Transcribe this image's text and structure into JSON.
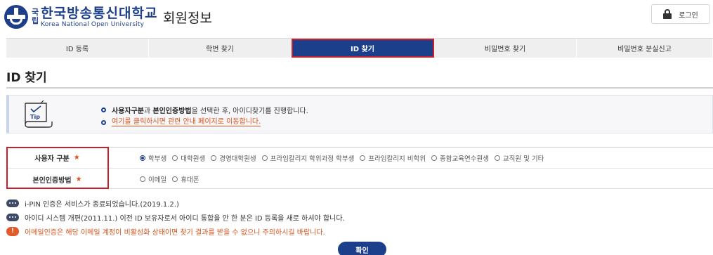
{
  "header": {
    "logo_guklip_top": "국",
    "logo_guklip_bottom": "립",
    "logo_ko": "한국방송통신대학교",
    "logo_en": "Korea National Open University",
    "page_heading": "회원정보",
    "login_label": "로그인"
  },
  "tabs": [
    {
      "label": "ID 등록",
      "active": false
    },
    {
      "label": "학번 찾기",
      "active": false
    },
    {
      "label": "ID 찾기",
      "active": true
    },
    {
      "label": "비밀번호 찾기",
      "active": false
    },
    {
      "label": "비밀번호 분실신고",
      "active": false
    }
  ],
  "section_title": "ID 찾기",
  "tip": {
    "icon_label": "Tip",
    "line1_strong_1": "사용자구분",
    "line1_mid": "과 ",
    "line1_strong_2": "본인인증방법",
    "line1_rest": "을 선택한 후, 아이디찾기를 진행합니다.",
    "line2_link": "여기를 클릭하시면 관련 안내 페이지로 이동합니다."
  },
  "form": {
    "user_type_label": "사용자 구분",
    "user_type_required": "★",
    "user_type_options": [
      "학부생",
      "대학원생",
      "경영대학원생",
      "프라임칼리지 학위과정 학부생",
      "프라임칼리지 비학위",
      "종합교육연수원생",
      "교직원 및 기타"
    ],
    "user_type_selected": "학부생",
    "auth_label": "본인인증방법",
    "auth_required": "★",
    "auth_options": [
      "이메일",
      "휴대폰"
    ]
  },
  "notices": [
    {
      "type": "info",
      "icon": "speech-dots-icon",
      "text": "i-PIN 인증은 서비스가 종료되었습니다.(2019.1.2.)"
    },
    {
      "type": "info",
      "icon": "speech-dots-icon",
      "text": "아이디 시스템 개편(2011.11.) 이전 ID 보유자로서 아이디 통합을 안 한 분은 ID 등록을 새로 하셔야 합니다."
    },
    {
      "type": "warn",
      "icon": "warning-icon",
      "text": "이메일인증은 해당 이메일 계정이 비활성화 상태이면 찾기 결과를 받을 수 없으니 주의하시길 바랍니다."
    }
  ],
  "confirm_label": "확인",
  "colors": {
    "brand_blue": "#1b3f8b",
    "highlight_red": "#c8202a",
    "accent_orange": "#d9541e"
  }
}
